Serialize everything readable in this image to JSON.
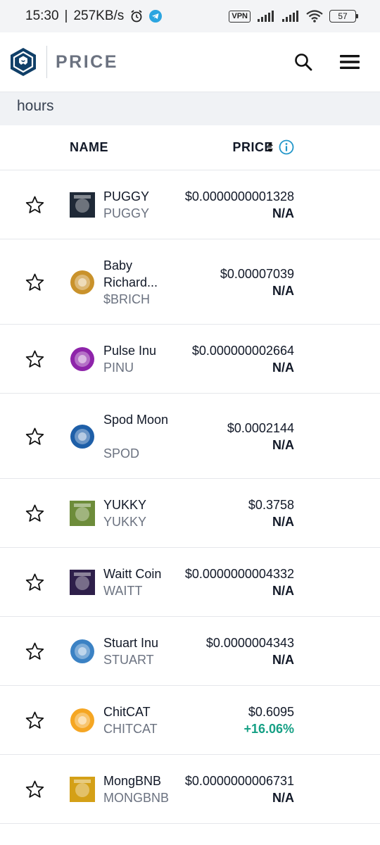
{
  "status_bar": {
    "time": "15:30",
    "separator": "|",
    "speed": "257KB/s",
    "vpn": "VPN",
    "battery": "57"
  },
  "header": {
    "brand": "PRICE",
    "search_icon": "search-icon",
    "menu_icon": "hamburger-menu-icon"
  },
  "notice": {
    "text": "hours"
  },
  "table": {
    "name_header": "NAME",
    "price_header": "PRICE"
  },
  "colors": {
    "positive": "#16a085",
    "neutral": "#111827",
    "accent": "#2196c9",
    "brand_dark": "#103f68"
  },
  "coins": [
    {
      "name": "PUGGY",
      "symbol": "PUGGY",
      "price": "$0.0000000001328",
      "change": "N/A",
      "icon_color": "#1f2937",
      "name_lines": 1
    },
    {
      "name": "Baby Richard...",
      "symbol": "$BRICH",
      "price": "$0.00007039",
      "change": "N/A",
      "icon_color": "#c9922b",
      "name_lines": 2
    },
    {
      "name": "Pulse Inu",
      "symbol": "PINU",
      "price": "$0.000000002664",
      "change": "N/A",
      "icon_color": "#8e24aa",
      "name_lines": 1
    },
    {
      "name": "Spod Moon",
      "symbol": "SPOD",
      "price": "$0.0002144",
      "change": "N/A",
      "icon_color": "#1e5fa8",
      "name_lines": 2
    },
    {
      "name": "YUKKY",
      "symbol": "YUKKY",
      "price": "$0.3758",
      "change": "N/A",
      "icon_color": "#6d8c3a",
      "name_lines": 1
    },
    {
      "name": "Waitt Coin",
      "symbol": "WAITT",
      "price": "$0.0000000004332",
      "change": "N/A",
      "icon_color": "#2e1f4a",
      "name_lines": 1
    },
    {
      "name": "Stuart Inu",
      "symbol": "STUART",
      "price": "$0.0000004343",
      "change": "N/A",
      "icon_color": "#3b82c4",
      "name_lines": 1
    },
    {
      "name": "ChitCAT",
      "symbol": "CHITCAT",
      "price": "$0.6095",
      "change": "+16.06%",
      "icon_color": "#f5a623",
      "name_lines": 1
    },
    {
      "name": "MongBNB",
      "symbol": "MONGBNB",
      "price": "$0.0000000006731",
      "change": "N/A",
      "icon_color": "#d4a017",
      "name_lines": 1
    }
  ]
}
